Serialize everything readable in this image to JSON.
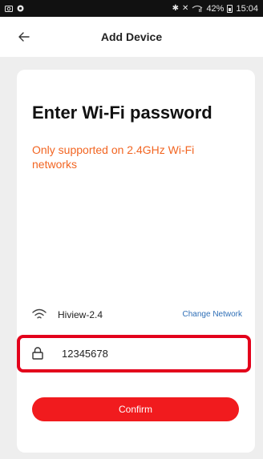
{
  "status_bar": {
    "battery": "42%",
    "time": "15:04"
  },
  "header": {
    "title": "Add Device"
  },
  "card": {
    "heading": "Enter Wi-Fi password",
    "note": "Only supported on 2.4GHz Wi-Fi networks",
    "wifi_name": "Hiview-2.4",
    "change_network_label": "Change Network",
    "password_value": "12345678",
    "confirm_label": "Confirm"
  },
  "colors": {
    "accent": "#f11b1e",
    "warning_text": "#f26522",
    "link": "#2f6fb7",
    "highlight_box": "#e3001b"
  },
  "icons": [
    "back-arrow-icon",
    "wifi-icon",
    "lock-icon",
    "camera-icon",
    "notification-icon",
    "bluetooth-icon",
    "mute-icon",
    "battery-icon"
  ]
}
